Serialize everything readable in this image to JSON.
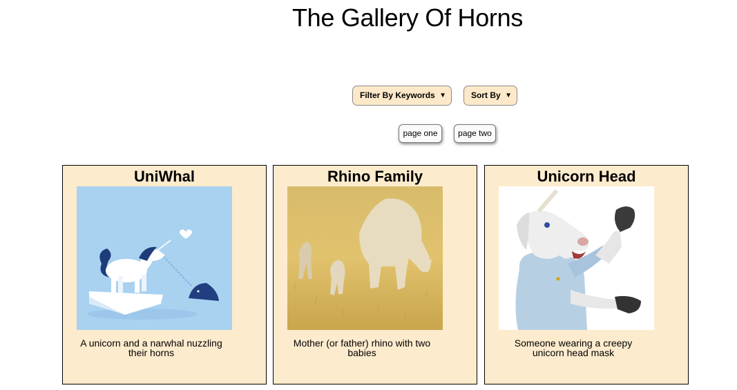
{
  "page": {
    "title": "The Gallery Of Horns"
  },
  "controls": {
    "filter_label": "Filter By Keywords",
    "sort_label": "Sort By",
    "page_one_label": "page one",
    "page_two_label": "page two"
  },
  "cards": [
    {
      "title": "UniWhal",
      "description": "A unicorn and a narwhal nuzzling their horns",
      "image": "unicorn-narwhal-illustration"
    },
    {
      "title": "Rhino Family",
      "description": "Mother (or father) rhino with two babies",
      "image": "rhino-family-photo"
    },
    {
      "title": "Unicorn Head",
      "description": "Someone wearing a creepy unicorn head mask",
      "image": "unicorn-mask-photo"
    }
  ],
  "colors": {
    "card_background": "#fdebcd",
    "select_background": "#fde9c9",
    "uniwhal_sky": "#a9d2f0"
  }
}
